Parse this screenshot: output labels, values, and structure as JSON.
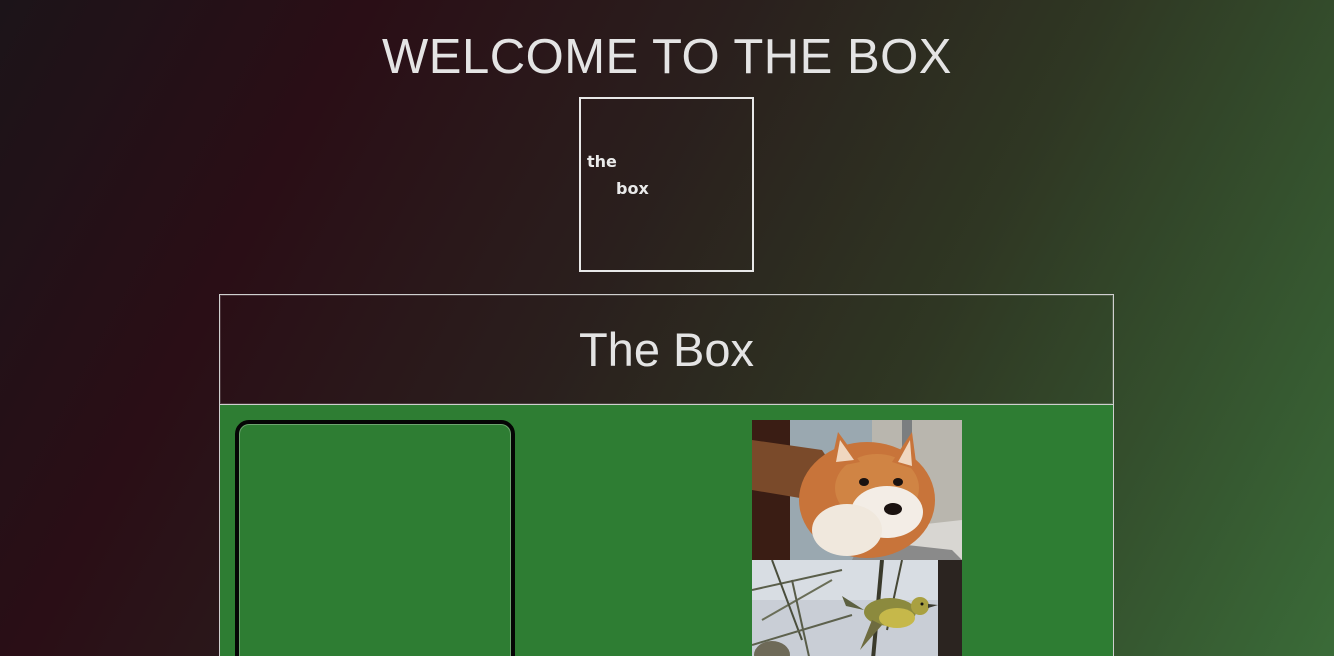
{
  "page": {
    "heading": "WELCOME TO THE BOX"
  },
  "logo": {
    "word_top": "the",
    "word_bottom": "box"
  },
  "panel": {
    "title": "The Box"
  },
  "colors": {
    "panel_green": "#2e7d33",
    "frame_white": "#e8e8e8",
    "text": "#e2e2e2"
  },
  "photos": [
    {
      "subject": "shiba-inu-dog"
    },
    {
      "subject": "yellow-bird-on-pine-branch"
    }
  ]
}
